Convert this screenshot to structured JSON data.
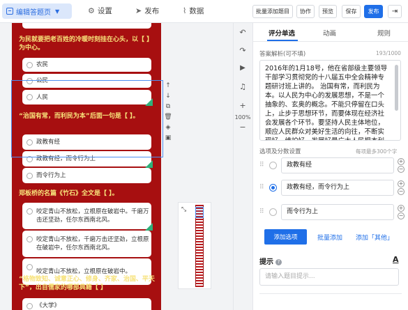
{
  "topbar": {
    "edit_tab": "编辑答题页",
    "nav": [
      {
        "label": "设置",
        "icon": "gear-icon",
        "glyph": "⚙"
      },
      {
        "label": "发布",
        "icon": "send-icon",
        "glyph": "✈"
      },
      {
        "label": "数据",
        "icon": "chart-icon",
        "glyph": "📈"
      }
    ],
    "buttons": {
      "batch_add": "批量添加题目",
      "collab": "协作",
      "preview": "预览",
      "save": "保存",
      "publish": "发布"
    },
    "exit_icon": "exit-icon"
  },
  "questions": [
    {
      "title": "为民就要把老百姓的冷暖时刻挂在心头，以【    】为中心。",
      "options": [
        "农民",
        "公民",
        "人民"
      ]
    },
    {
      "title": "“治国有常，而利民为本”后面一句是【  】。",
      "options": [
        "政教有经",
        "政教有经，而令行为上",
        "而令行为上"
      ]
    },
    {
      "title": "郑板桥的名篇《竹石》全文是【  】。",
      "options": [
        "咬定青山不放松，立根原在破岩中。千磨万击还坚劲，任尔东西南北风。",
        "咬定青山不放松，千磨万击还坚劲，立根原在破岩中，任尔东西南北风。",
        "咬定青山不放松，立根原在破岩中。"
      ]
    },
    {
      "title": "“格物致知、诚意正心、修身、齐家、治国、平天下”，出自儒家的哪部典籍【  】",
      "options": [
        "《大学》"
      ]
    }
  ],
  "vtools": {
    "zoom": "100%"
  },
  "panel": {
    "tabs": [
      "评分单选",
      "动画",
      "规则"
    ],
    "analysis_label": "答案解析(可不填)",
    "analysis_counter": "193/1000",
    "analysis_text": "2016年的1月18号，他在省部级主要领导干部学习贯彻党的十八届五中全会精神专题研讨班上讲的。  治国有常，而利民为本。以人民为中心的发展思想，不是一个抽象的、玄奥的概念。不能只停留在口头上，止步于思想环节，而要体现在经济社会发展各个环节。要坚持人民主体地位，顺应人民群众对美好生活的向往，不断实现好、维护好、发展好最广大人民根本利益。",
    "options_label": "选项及分数设置",
    "options_note": "每项最多300个字",
    "option_values": [
      "政教有经",
      "政教有经，而令行为上",
      "而令行为上"
    ],
    "selected_option": 1,
    "add_option": "添加选项",
    "batch_add": "批量添加",
    "add_other": "添加「其他」",
    "hint_label": "提示",
    "hint_placeholder": "请输入题目提示..."
  }
}
